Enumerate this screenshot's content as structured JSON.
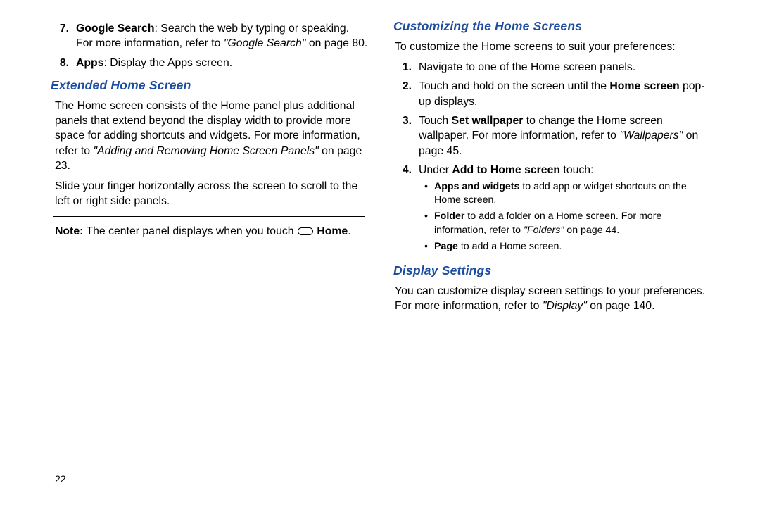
{
  "left": {
    "li7": {
      "num": "7.",
      "strong": "Google Search",
      "t1": ": Search the web by typing or speaking. For more information, refer to ",
      "ref": "\"Google Search\"",
      "t2": " on page 80."
    },
    "li8": {
      "num": "8.",
      "strong": "Apps",
      "t1": ": Display the Apps screen."
    },
    "h1": "Extended Home Screen",
    "p1a": "The Home screen consists of the Home panel plus additional panels that extend beyond the display width to provide more space for adding shortcuts and widgets. For more information, refer to ",
    "p1ref": "\"Adding and Removing Home Screen Panels\"",
    "p1b": " on page 23.",
    "p2": "Slide your finger horizontally across the screen to scroll to the left or right side panels.",
    "note_label": "Note:",
    "note_text": " The center panel displays when you touch ",
    "note_home": " Home",
    "note_period": "."
  },
  "right": {
    "h1": "Customizing the Home Screens",
    "p1": "To customize the Home screens to suit your preferences:",
    "li1": {
      "num": "1.",
      "t": "Navigate to one of the Home screen panels."
    },
    "li2": {
      "num": "2.",
      "t1": "Touch and hold on the screen until the ",
      "strong": "Home screen",
      "t2": " pop-up displays."
    },
    "li3": {
      "num": "3.",
      "t1": "Touch ",
      "strong": "Set wallpaper",
      "t2": " to change the Home screen wallpaper. For more information, refer to ",
      "ref": "\"Wallpapers\"",
      "t3": " on page 45."
    },
    "li4": {
      "num": "4.",
      "t1": "Under ",
      "strong": "Add to Home screen",
      "t2": " touch:"
    },
    "b1": {
      "strong": "Apps and widgets",
      "t": " to add app or widget shortcuts on the Home screen."
    },
    "b2": {
      "strong": "Folder",
      "t1": " to add a folder on a Home screen. For more information, refer to ",
      "ref": "\"Folders\"",
      "t2": " on page 44."
    },
    "b3": {
      "strong": "Page",
      "t": " to add a Home screen."
    },
    "h2": "Display Settings",
    "p2a": "You can customize display screen settings to your preferences. For more information, refer to ",
    "p2ref": "\"Display\"",
    "p2b": " on page 140."
  },
  "page_number": "22"
}
